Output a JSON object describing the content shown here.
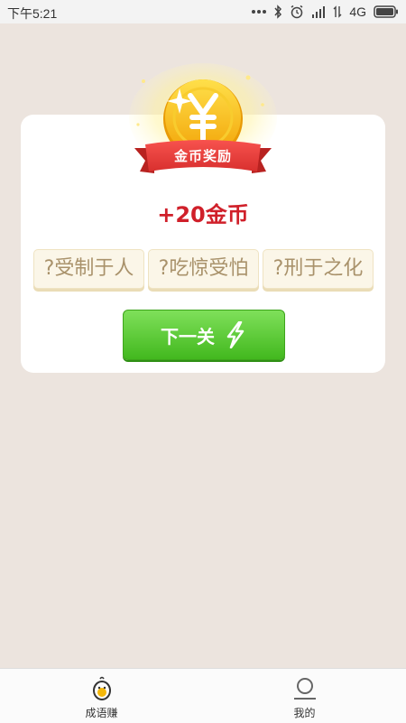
{
  "status_bar": {
    "time": "下午5:21",
    "network": "4G"
  },
  "reward_card": {
    "ribbon_label": "金币奖励",
    "reward_text": "+20金币",
    "idioms": [
      "?受制于人",
      "?吃惊受怕",
      "?刑于之化"
    ],
    "next_button_label": "下一关"
  },
  "bottom_nav": {
    "items": [
      {
        "label": "成语赚",
        "icon": "chick-icon",
        "active": true
      },
      {
        "label": "我的",
        "icon": "person-icon",
        "active": false
      }
    ]
  },
  "colors": {
    "background": "#ece4de",
    "reward_red": "#d0202a",
    "button_green": "#42b81e",
    "coin_gold": "#f5b80a"
  }
}
